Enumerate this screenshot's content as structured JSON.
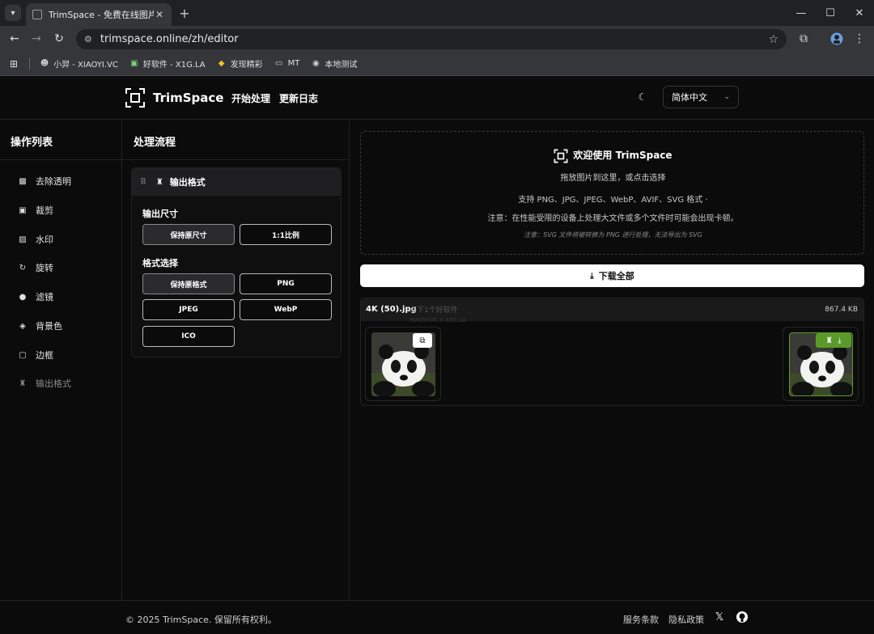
{
  "browser": {
    "tab_title": "TrimSpace - 免费在线图片编辑",
    "url": "trimspace.online/zh/editor",
    "bookmarks": [
      {
        "label": "小羿 - XIAOYI.VC",
        "icon": "avatar-icon"
      },
      {
        "label": "好软件 - X1G.LA",
        "icon": "app-icon"
      },
      {
        "label": "发现精彩",
        "icon": "discover-icon"
      },
      {
        "label": "MT",
        "icon": "folder-icon"
      },
      {
        "label": "本地测试",
        "icon": "globe-icon"
      }
    ]
  },
  "header": {
    "brand": "TrimSpace",
    "nav": [
      "开始处理",
      "更新日志"
    ],
    "language": "简体中文"
  },
  "left_panel": {
    "title": "操作列表",
    "items": [
      {
        "label": "去除透明",
        "icon": "transparency-icon"
      },
      {
        "label": "裁剪",
        "icon": "crop-icon"
      },
      {
        "label": "水印",
        "icon": "image-icon"
      },
      {
        "label": "旋转",
        "icon": "rotate-icon"
      },
      {
        "label": "滤镜",
        "icon": "filter-icon"
      },
      {
        "label": "背景色",
        "icon": "paint-bucket-icon"
      },
      {
        "label": "边框",
        "icon": "border-icon"
      },
      {
        "label": "输出格式",
        "icon": "brush-icon"
      }
    ]
  },
  "middle_panel": {
    "title": "处理流程",
    "card_title": "输出格式",
    "size_label": "输出尺寸",
    "size_options": [
      "保持原尺寸",
      "1:1比例"
    ],
    "format_label": "格式选择",
    "format_options": [
      "保持原格式",
      "PNG",
      "JPEG",
      "WebP",
      "ICO"
    ]
  },
  "dropzone": {
    "title": "欢迎使用 TrimSpace",
    "hint": "拖放图片到这里，或点击选择",
    "supported": "支持 PNG、JPG、JPEG、WebP、AVIF、SVG 格式 ·",
    "notice": "注意：在性能受限的设备上处理大文件或多个文件时可能会出现卡顿。",
    "svg_notice": "注意：SVG 文件将被转换为 PNG 进行处理，无法导出为 SVG"
  },
  "download_all": "下载全部",
  "file": {
    "name": "4K (50).jpg",
    "size": "867.4 KB",
    "watermark_1": "@下1个好软件",
    "watermark_2": "XIAOYI.VC // X1G.LA"
  },
  "footer": {
    "copyright": "© 2025 TrimSpace. 保留所有权利。",
    "terms": "服务条款",
    "privacy": "隐私政策"
  },
  "colors": {
    "accent_green": "#5a9a2a",
    "background": "#0b0b0c"
  }
}
